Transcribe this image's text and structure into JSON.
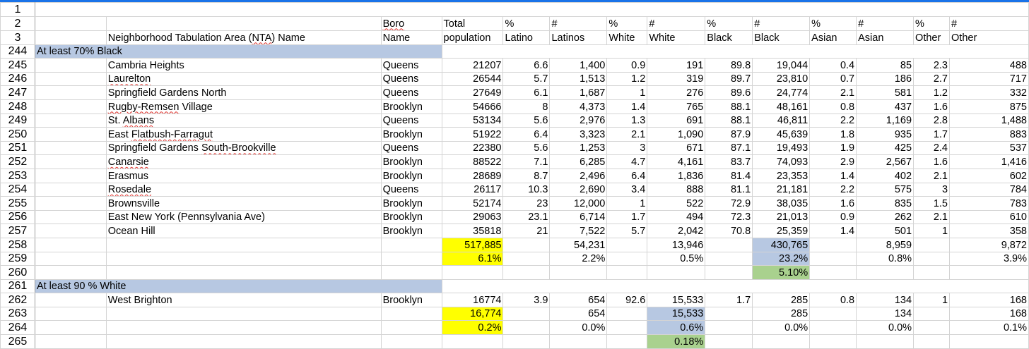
{
  "header_row2": [
    "Boro",
    "Total",
    "%",
    "#",
    "%",
    "#",
    "%",
    "#",
    "%",
    "#",
    "%",
    "#"
  ],
  "header_row3": [
    "Neighborhood Tabulation Area (NTA) Name",
    "Name",
    "population",
    "Latino",
    "Latinos",
    "White",
    "White",
    "Black",
    "Black",
    "Asian",
    "Asian",
    "Other",
    "Other"
  ],
  "row_numbers": {
    "r1": "1",
    "r2": "2",
    "r3": "3",
    "r244": "244",
    "r258": "258",
    "r259": "259",
    "r260": "260",
    "r261": "261",
    "r262": "262",
    "r263": "263",
    "r264": "264",
    "r265": "265"
  },
  "group_black": "At least 70% Black",
  "rows_black": [
    {
      "n": "245",
      "name": "Cambria Heights",
      "boro": "Queens",
      "pop": "21207",
      "pl": "6.6",
      "nl": "1,400",
      "pw": "0.9",
      "nw": "191",
      "pb": "89.8",
      "nb": "19,044",
      "pa": "0.4",
      "na": "85",
      "po": "2.3",
      "no": "488"
    },
    {
      "n": "246",
      "name": "Laurelton",
      "boro": "Queens",
      "pop": "26544",
      "pl": "5.7",
      "nl": "1,513",
      "pw": "1.2",
      "nw": "319",
      "pb": "89.7",
      "nb": "23,810",
      "pa": "0.7",
      "na": "186",
      "po": "2.7",
      "no": "717"
    },
    {
      "n": "247",
      "name": "Springfield Gardens North",
      "boro": "Queens",
      "pop": "27649",
      "pl": "6.1",
      "nl": "1,687",
      "pw": "1",
      "nw": "276",
      "pb": "89.6",
      "nb": "24,774",
      "pa": "2.1",
      "na": "581",
      "po": "1.2",
      "no": "332"
    },
    {
      "n": "248",
      "name": "Rugby-Remsen Village",
      "boro": "Brooklyn",
      "pop": "54666",
      "pl": "8",
      "nl": "4,373",
      "pw": "1.4",
      "nw": "765",
      "pb": "88.1",
      "nb": "48,161",
      "pa": "0.8",
      "na": "437",
      "po": "1.6",
      "no": "875"
    },
    {
      "n": "249",
      "name": "St. Albans",
      "boro": "Queens",
      "pop": "53134",
      "pl": "5.6",
      "nl": "2,976",
      "pw": "1.3",
      "nw": "691",
      "pb": "88.1",
      "nb": "46,811",
      "pa": "2.2",
      "na": "1,169",
      "po": "2.8",
      "no": "1,488"
    },
    {
      "n": "250",
      "name": "East Flatbush-Farragut",
      "boro": "Brooklyn",
      "pop": "51922",
      "pl": "6.4",
      "nl": "3,323",
      "pw": "2.1",
      "nw": "1,090",
      "pb": "87.9",
      "nb": "45,639",
      "pa": "1.8",
      "na": "935",
      "po": "1.7",
      "no": "883"
    },
    {
      "n": "251",
      "name": "Springfield Gardens South-Brookville",
      "boro": "Queens",
      "pop": "22380",
      "pl": "5.6",
      "nl": "1,253",
      "pw": "3",
      "nw": "671",
      "pb": "87.1",
      "nb": "19,493",
      "pa": "1.9",
      "na": "425",
      "po": "2.4",
      "no": "537"
    },
    {
      "n": "252",
      "name": "Canarsie",
      "boro": "Brooklyn",
      "pop": "88522",
      "pl": "7.1",
      "nl": "6,285",
      "pw": "4.7",
      "nw": "4,161",
      "pb": "83.7",
      "nb": "74,093",
      "pa": "2.9",
      "na": "2,567",
      "po": "1.6",
      "no": "1,416"
    },
    {
      "n": "253",
      "name": "Erasmus",
      "boro": "Brooklyn",
      "pop": "28689",
      "pl": "8.7",
      "nl": "2,496",
      "pw": "6.4",
      "nw": "1,836",
      "pb": "81.4",
      "nb": "23,353",
      "pa": "1.4",
      "na": "402",
      "po": "2.1",
      "no": "602"
    },
    {
      "n": "254",
      "name": "Rosedale",
      "boro": "Queens",
      "pop": "26117",
      "pl": "10.3",
      "nl": "2,690",
      "pw": "3.4",
      "nw": "888",
      "pb": "81.1",
      "nb": "21,181",
      "pa": "2.2",
      "na": "575",
      "po": "3",
      "no": "784"
    },
    {
      "n": "255",
      "name": "Brownsville",
      "boro": "Brooklyn",
      "pop": "52174",
      "pl": "23",
      "nl": "12,000",
      "pw": "1",
      "nw": "522",
      "pb": "72.9",
      "nb": "38,035",
      "pa": "1.6",
      "na": "835",
      "po": "1.5",
      "no": "783"
    },
    {
      "n": "256",
      "name": "East New York (Pennsylvania Ave)",
      "boro": "Brooklyn",
      "pop": "29063",
      "pl": "23.1",
      "nl": "6,714",
      "pw": "1.7",
      "nw": "494",
      "pb": "72.3",
      "nb": "21,013",
      "pa": "0.9",
      "na": "262",
      "po": "2.1",
      "no": "610"
    },
    {
      "n": "257",
      "name": "Ocean Hill",
      "boro": "Brooklyn",
      "pop": "35818",
      "pl": "21",
      "nl": "7,522",
      "pw": "5.7",
      "nw": "2,042",
      "pb": "70.8",
      "nb": "25,359",
      "pa": "1.4",
      "na": "501",
      "po": "1",
      "no": "358"
    }
  ],
  "totals_black": {
    "pop": "517,885",
    "nl": "54,231",
    "nw": "13,946",
    "nb": "430,765",
    "na": "8,959",
    "no": "9,872"
  },
  "shares_black": {
    "pop": "6.1%",
    "nl": "2.2%",
    "nw": "0.5%",
    "nb": "23.2%",
    "na": "0.8%",
    "no": "3.9%"
  },
  "extra_black": {
    "nb": "5.10%"
  },
  "group_white": "At least 90 % White",
  "rows_white": [
    {
      "n": "262",
      "name": "West Brighton",
      "boro": "Brooklyn",
      "pop": "16774",
      "pl": "3.9",
      "nl": "654",
      "pw": "92.6",
      "nw": "15,533",
      "pb": "1.7",
      "nb": "285",
      "pa": "0.8",
      "na": "134",
      "po": "1",
      "no": "168"
    }
  ],
  "totals_white": {
    "pop": "16,774",
    "nl": "654",
    "nw": "15,533",
    "nb": "285",
    "na": "134",
    "no": "168"
  },
  "shares_white": {
    "pop": "0.2%",
    "nl": "0.0%",
    "nw": "0.6%",
    "nb": "0.0%",
    "na": "0.0%",
    "no": "0.1%"
  },
  "extra_white": {
    "nw": "0.18%"
  },
  "colors": {
    "highlight_yellow": "#ffff00",
    "highlight_blue": "#b7c8e2",
    "highlight_green": "#a9d18e",
    "selection_bar": "#1a73e8"
  }
}
